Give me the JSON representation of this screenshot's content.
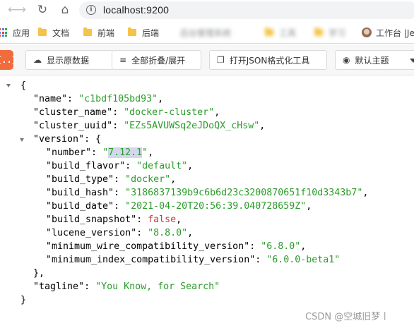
{
  "browser": {
    "url": "localhost:9200",
    "bookmarks": {
      "apps": "应用",
      "docs": "文档",
      "frontend": "前端",
      "backend": "后端",
      "blurred1": "后台管理系统",
      "blurred2": "工具",
      "blurred3": "学习",
      "workbench": "工作台 |Je"
    }
  },
  "toolbar": {
    "logo": "{..}",
    "show_raw": "显示原数据",
    "collapse_all": "全部折叠/展开",
    "open_tool": "打开JSON格式化工具",
    "theme": "默认主题"
  },
  "json_lines": {
    "l1": "{",
    "name_key": "\"name\"",
    "name_val": "\"c1bdf105bd93\"",
    "cluster_name_key": "\"cluster_name\"",
    "cluster_name_val": "\"docker-cluster\"",
    "cluster_uuid_key": "\"cluster_uuid\"",
    "cluster_uuid_val": "\"EZs5AVUWSq2eJDoQX_cHsw\"",
    "version_key": "\"version\"",
    "number_key": "\"number\"",
    "number_val": "7.12.1",
    "build_flavor_key": "\"build_flavor\"",
    "build_flavor_val": "\"default\"",
    "build_type_key": "\"build_type\"",
    "build_type_val": "\"docker\"",
    "build_hash_key": "\"build_hash\"",
    "build_hash_val": "\"3186837139b9c6b6d23c3200870651f10d3343b7\"",
    "build_date_key": "\"build_date\"",
    "build_date_val": "\"2021-04-20T20:56:39.040728659Z\"",
    "build_snapshot_key": "\"build_snapshot\"",
    "build_snapshot_val": "false",
    "lucene_version_key": "\"lucene_version\"",
    "lucene_version_val": "\"8.8.0\"",
    "min_wire_key": "\"minimum_wire_compatibility_version\"",
    "min_wire_val": "\"6.8.0\"",
    "min_index_key": "\"minimum_index_compatibility_version\"",
    "min_index_val": "\"6.0.0-beta1\"",
    "tagline_key": "\"tagline\"",
    "tagline_val": "\"You Know, for Search\""
  },
  "watermark": "CSDN @空城旧梦丨",
  "colors": {
    "string": "#2a9c2a",
    "boolean": "#c83a3a",
    "highlight": "#d2d7ec",
    "logo": "#f16b3c"
  }
}
